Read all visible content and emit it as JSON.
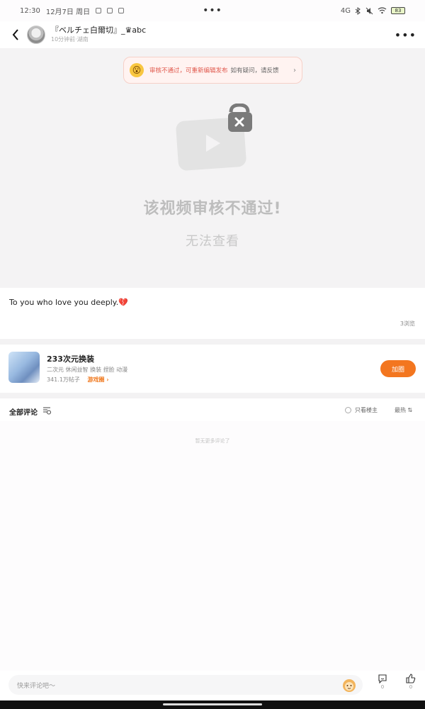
{
  "status_bar": {
    "time": "12:30",
    "date": "12月7日 周日",
    "center_dots": "•••",
    "network": "4G",
    "battery": "83"
  },
  "header": {
    "user_name": "『ベルチェ白爾切』_♛abc",
    "user_meta": "10分钟前·湖南",
    "more": "•••"
  },
  "video": {
    "notice_text": "审核不通过，可重新编辑发布",
    "notice_tail": "如有疑问，请反馈",
    "notice_arrow": "›",
    "fail_title": "该视频审核不通过!",
    "fail_subtitle": "无法查看"
  },
  "post": {
    "description": "To you who love you deeply.💔",
    "views": "3浏览"
  },
  "circle": {
    "title": "233次元换装",
    "tags": "二次元  休闲益智  换装  捏脸  动漫",
    "stats": "341.1万帖子",
    "link": "游戏圈 ›",
    "join_label": "加圈"
  },
  "comments": {
    "title": "全部评论",
    "read_filter": "只看楼主",
    "sort": "最热 ⇅",
    "empty_text": "暂无更多评论了"
  },
  "bottom_bar": {
    "input_placeholder": "快来评论吧～",
    "comment_count": "0",
    "like_count": "0"
  },
  "colors": {
    "accent": "#f3761f",
    "notice_red": "#e0584c",
    "video_bg": "#f4f3f4"
  }
}
